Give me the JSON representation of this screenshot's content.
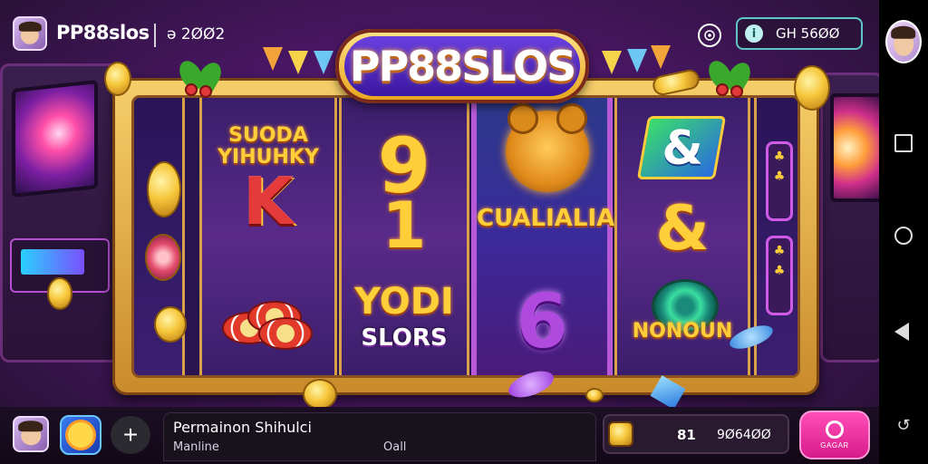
{
  "top_bar": {
    "brand": "PP88slos",
    "session_code": "ә 2ØØ2",
    "balance": "GH 56ØØ",
    "balance_icon": "info-icon"
  },
  "logo": {
    "text": "PP88SLOS"
  },
  "reels": [
    {
      "symbols": []
    },
    {
      "symbols": [
        "SUODA YIHUHKY",
        "K",
        "chips"
      ]
    },
    {
      "symbols": [
        "9",
        "1",
        "YODI",
        "SLORS"
      ]
    },
    {
      "symbols": [
        "bear",
        "CUALIALIA",
        "6"
      ]
    },
    {
      "symbols": [
        "&",
        "&",
        "NONOUN"
      ]
    },
    {
      "symbols": []
    }
  ],
  "reel_labels": {
    "r1_title": "SUODA YIHUHKY",
    "r1_letter": "K",
    "r2_top": "9",
    "r2_mid": "1",
    "r2_word": "YODI",
    "r2_sub": "SLORS",
    "r3_word": "CUALIALIA",
    "r3_num": "6",
    "r4_top": "&",
    "r4_mid": "&",
    "r4_word": "NONOUN"
  },
  "side_pills": {
    "top_a": "♣",
    "top_b": "♣",
    "bot_a": "♣",
    "bot_b": "♣"
  },
  "bottom_bar": {
    "message_title": "Permainon Shihulci",
    "message_sub": "Manline",
    "message_meta": "Oall",
    "bet_lines": "81",
    "bet_total": "9Ø64ØØ",
    "spin_label": "GAGAR"
  },
  "icons": {
    "target": "target-icon",
    "add": "plus-icon",
    "spin": "search-icon"
  },
  "colors": {
    "accent_pink": "#e0208e",
    "accent_teal": "#5cc6c8",
    "gold": "#f6c63a",
    "purple_bg": "#4a1766"
  }
}
